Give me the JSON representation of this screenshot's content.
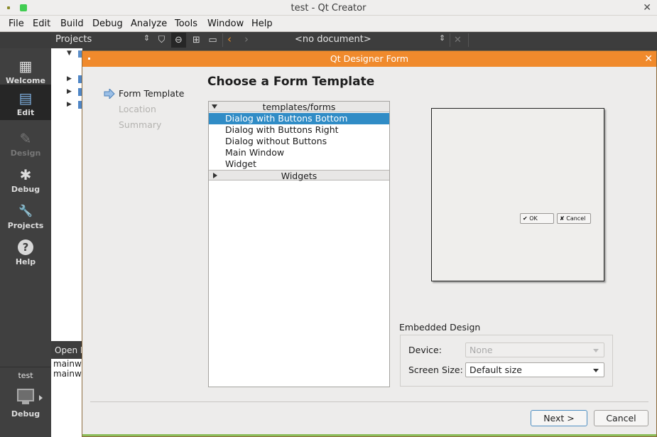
{
  "window": {
    "title": "test - Qt Creator",
    "close_glyph": "✕"
  },
  "menu": [
    "File",
    "Edit",
    "Build",
    "Debug",
    "Analyze",
    "Tools",
    "Window",
    "Help"
  ],
  "toolbar": {
    "projects_label": "Projects",
    "document_combo": "<no document>",
    "icons": [
      "up-down-icon",
      "filter-icon",
      "link-icon",
      "split-icon",
      "new-window-icon",
      "back-icon",
      "forward-icon",
      "close-document-icon"
    ]
  },
  "modes": [
    {
      "label": "Welcome",
      "icon": "grid-icon",
      "glyph": "▦"
    },
    {
      "label": "Edit",
      "icon": "document-icon",
      "glyph": "▤"
    },
    {
      "label": "Design",
      "icon": "pencil-icon",
      "glyph": "✎"
    },
    {
      "label": "Debug",
      "icon": "bug-icon",
      "glyph": "✱"
    },
    {
      "label": "Projects",
      "icon": "wrench-icon",
      "glyph": "🔧"
    },
    {
      "label": "Help",
      "icon": "help-icon",
      "glyph": "?"
    }
  ],
  "kit": {
    "project": "test",
    "mode": "Debug"
  },
  "open_documents": {
    "header": "Open Documents",
    "items": [
      "mainwindow.cpp",
      "mainwindow.h"
    ]
  },
  "dialog": {
    "title": "Qt Designer Form",
    "close_glyph": "✕",
    "page_title": "Choose a Form Template",
    "steps": [
      "Form Template",
      "Location",
      "Summary"
    ],
    "groups": {
      "forms": "templates/forms",
      "widgets": "Widgets"
    },
    "templates": [
      "Dialog with Buttons Bottom",
      "Dialog with Buttons Right",
      "Dialog without Buttons",
      "Main Window",
      "Widget"
    ],
    "selected_template": "Dialog with Buttons Bottom",
    "preview": {
      "ok": "OK",
      "cancel": "Cancel"
    },
    "embedded": {
      "title": "Embedded Design",
      "device_label": "Device:",
      "device_value": "None",
      "screen_label": "Screen Size:",
      "screen_value": "Default size"
    },
    "buttons": {
      "next": "Next >",
      "cancel": "Cancel"
    }
  },
  "colors": {
    "accent": "#308cc6",
    "dialog_title": "#f08a2c",
    "sidebar": "#404040"
  }
}
